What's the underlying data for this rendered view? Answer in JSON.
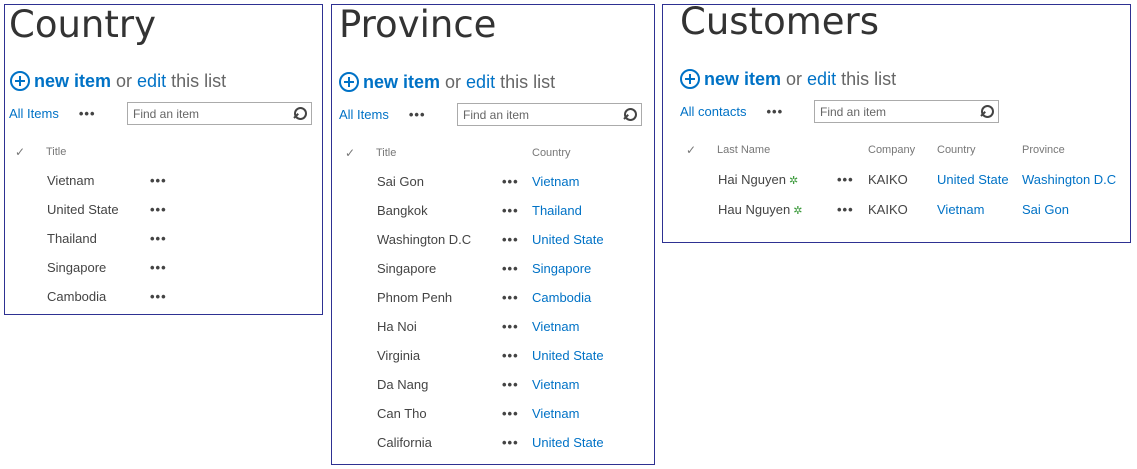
{
  "common": {
    "new_item": "new item",
    "or": "or",
    "edit": "edit",
    "this_list": "this list",
    "search_placeholder": "Find an item",
    "ellipsis": "•••",
    "check": "✓",
    "new_badge": "✲"
  },
  "country": {
    "title": "Country",
    "view_label": "All Items",
    "col_title": "Title",
    "rows": [
      "Vietnam",
      "United State",
      "Thailand",
      "Singapore",
      "Cambodia"
    ]
  },
  "province": {
    "title": "Province",
    "view_label": "All Items",
    "col_title": "Title",
    "col_country": "Country",
    "rows": [
      {
        "title": "Sai Gon",
        "country": "Vietnam"
      },
      {
        "title": "Bangkok",
        "country": "Thailand"
      },
      {
        "title": "Washington D.C",
        "country": "United State"
      },
      {
        "title": "Singapore",
        "country": "Singapore"
      },
      {
        "title": "Phnom Penh",
        "country": "Cambodia"
      },
      {
        "title": "Ha Noi",
        "country": "Vietnam"
      },
      {
        "title": "Virginia",
        "country": "United State"
      },
      {
        "title": "Da Nang",
        "country": "Vietnam"
      },
      {
        "title": "Can Tho",
        "country": "Vietnam"
      },
      {
        "title": "California",
        "country": "United State"
      }
    ]
  },
  "customers": {
    "title": "Customers",
    "view_label": "All contacts",
    "col_last_name": "Last Name",
    "col_company": "Company",
    "col_country": "Country",
    "col_province": "Province",
    "rows": [
      {
        "last_name": "Hai Nguyen",
        "company": "KAIKO",
        "country": "United State",
        "province": "Washington D.C"
      },
      {
        "last_name": "Hau Nguyen",
        "company": "KAIKO",
        "country": "Vietnam",
        "province": "Sai Gon"
      }
    ]
  },
  "colors": {
    "accent": "#0072c6",
    "border": "#2e3192",
    "text": "#444444",
    "new_badge": "#3b9a3b"
  }
}
